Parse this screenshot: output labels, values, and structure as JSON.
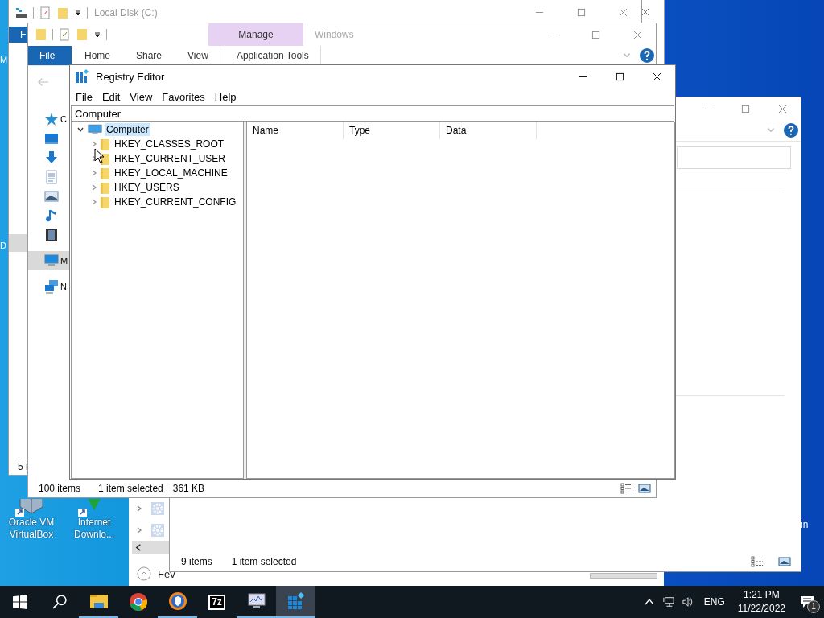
{
  "desktop": {
    "edge_labels": [
      "M",
      "D"
    ],
    "cut_label": "in",
    "icons": [
      {
        "kind": "virtualbox",
        "label": "Oracle VM VirtualBox"
      },
      {
        "kind": "downloader",
        "label": "Internet Downlo..."
      }
    ]
  },
  "local_disk_window": {
    "title": "Local Disk (C:)",
    "file_tab": "F",
    "status": "5 i"
  },
  "explorer_window": {
    "title": "Windows",
    "context_tab": "Manage",
    "tabs": [
      {
        "label": "File",
        "kind": "file"
      },
      {
        "label": "Home",
        "kind": "plain"
      },
      {
        "label": "Share",
        "kind": "plain"
      },
      {
        "label": "View",
        "kind": "plain"
      },
      {
        "label": "Application Tools",
        "kind": "context"
      }
    ],
    "nav_items": [
      {
        "kind": "star",
        "label": "C",
        "selected": false
      },
      {
        "kind": "desktop",
        "selected": false
      },
      {
        "kind": "download",
        "selected": false
      },
      {
        "kind": "document",
        "selected": false
      },
      {
        "kind": "picture",
        "selected": false
      },
      {
        "kind": "music",
        "selected": false
      },
      {
        "kind": "video",
        "selected": false
      },
      {
        "kind": "computer",
        "label": "M",
        "selected": true
      },
      {
        "kind": "network",
        "label": "N",
        "selected": false
      }
    ],
    "status": {
      "count": "100 items",
      "selection": "1 item selected",
      "size": "361 KB"
    }
  },
  "task_window": {
    "rows": [
      {
        "expanded": false
      },
      {
        "expanded": false
      }
    ],
    "details_toggle": "Fev"
  },
  "right_window": {
    "status": {
      "count": "9 items",
      "selection": "1 item selected"
    }
  },
  "registry": {
    "title": "Registry Editor",
    "menu": [
      "File",
      "Edit",
      "View",
      "Favorites",
      "Help"
    ],
    "address": "Computer",
    "tree": [
      {
        "label": "Computer",
        "expanded": true,
        "selected": true,
        "children": [
          {
            "label": "HKEY_CLASSES_ROOT",
            "expanded": false,
            "selected": false
          },
          {
            "label": "HKEY_CURRENT_USER",
            "expanded": false,
            "selected": false
          },
          {
            "label": "HKEY_LOCAL_MACHINE",
            "expanded": false,
            "selected": false
          },
          {
            "label": "HKEY_USERS",
            "expanded": false,
            "selected": false
          },
          {
            "label": "HKEY_CURRENT_CONFIG",
            "expanded": false,
            "selected": false
          }
        ]
      }
    ],
    "columns": [
      "Name",
      "Type",
      "Data"
    ]
  },
  "taskbar": {
    "apps": [
      {
        "kind": "explorer",
        "running": true,
        "selected": false
      },
      {
        "kind": "chrome",
        "running": false,
        "selected": false
      },
      {
        "kind": "brave",
        "running": true,
        "selected": false
      },
      {
        "kind": "sevenzip",
        "text": "7z",
        "running": false,
        "selected": false
      },
      {
        "kind": "monitor",
        "running": true,
        "selected": false
      },
      {
        "kind": "registry",
        "running": true,
        "selected": true
      }
    ],
    "tray": {
      "language": "ENG",
      "time": "1:21 PM",
      "date": "11/22/2022",
      "notifications": "1"
    }
  }
}
